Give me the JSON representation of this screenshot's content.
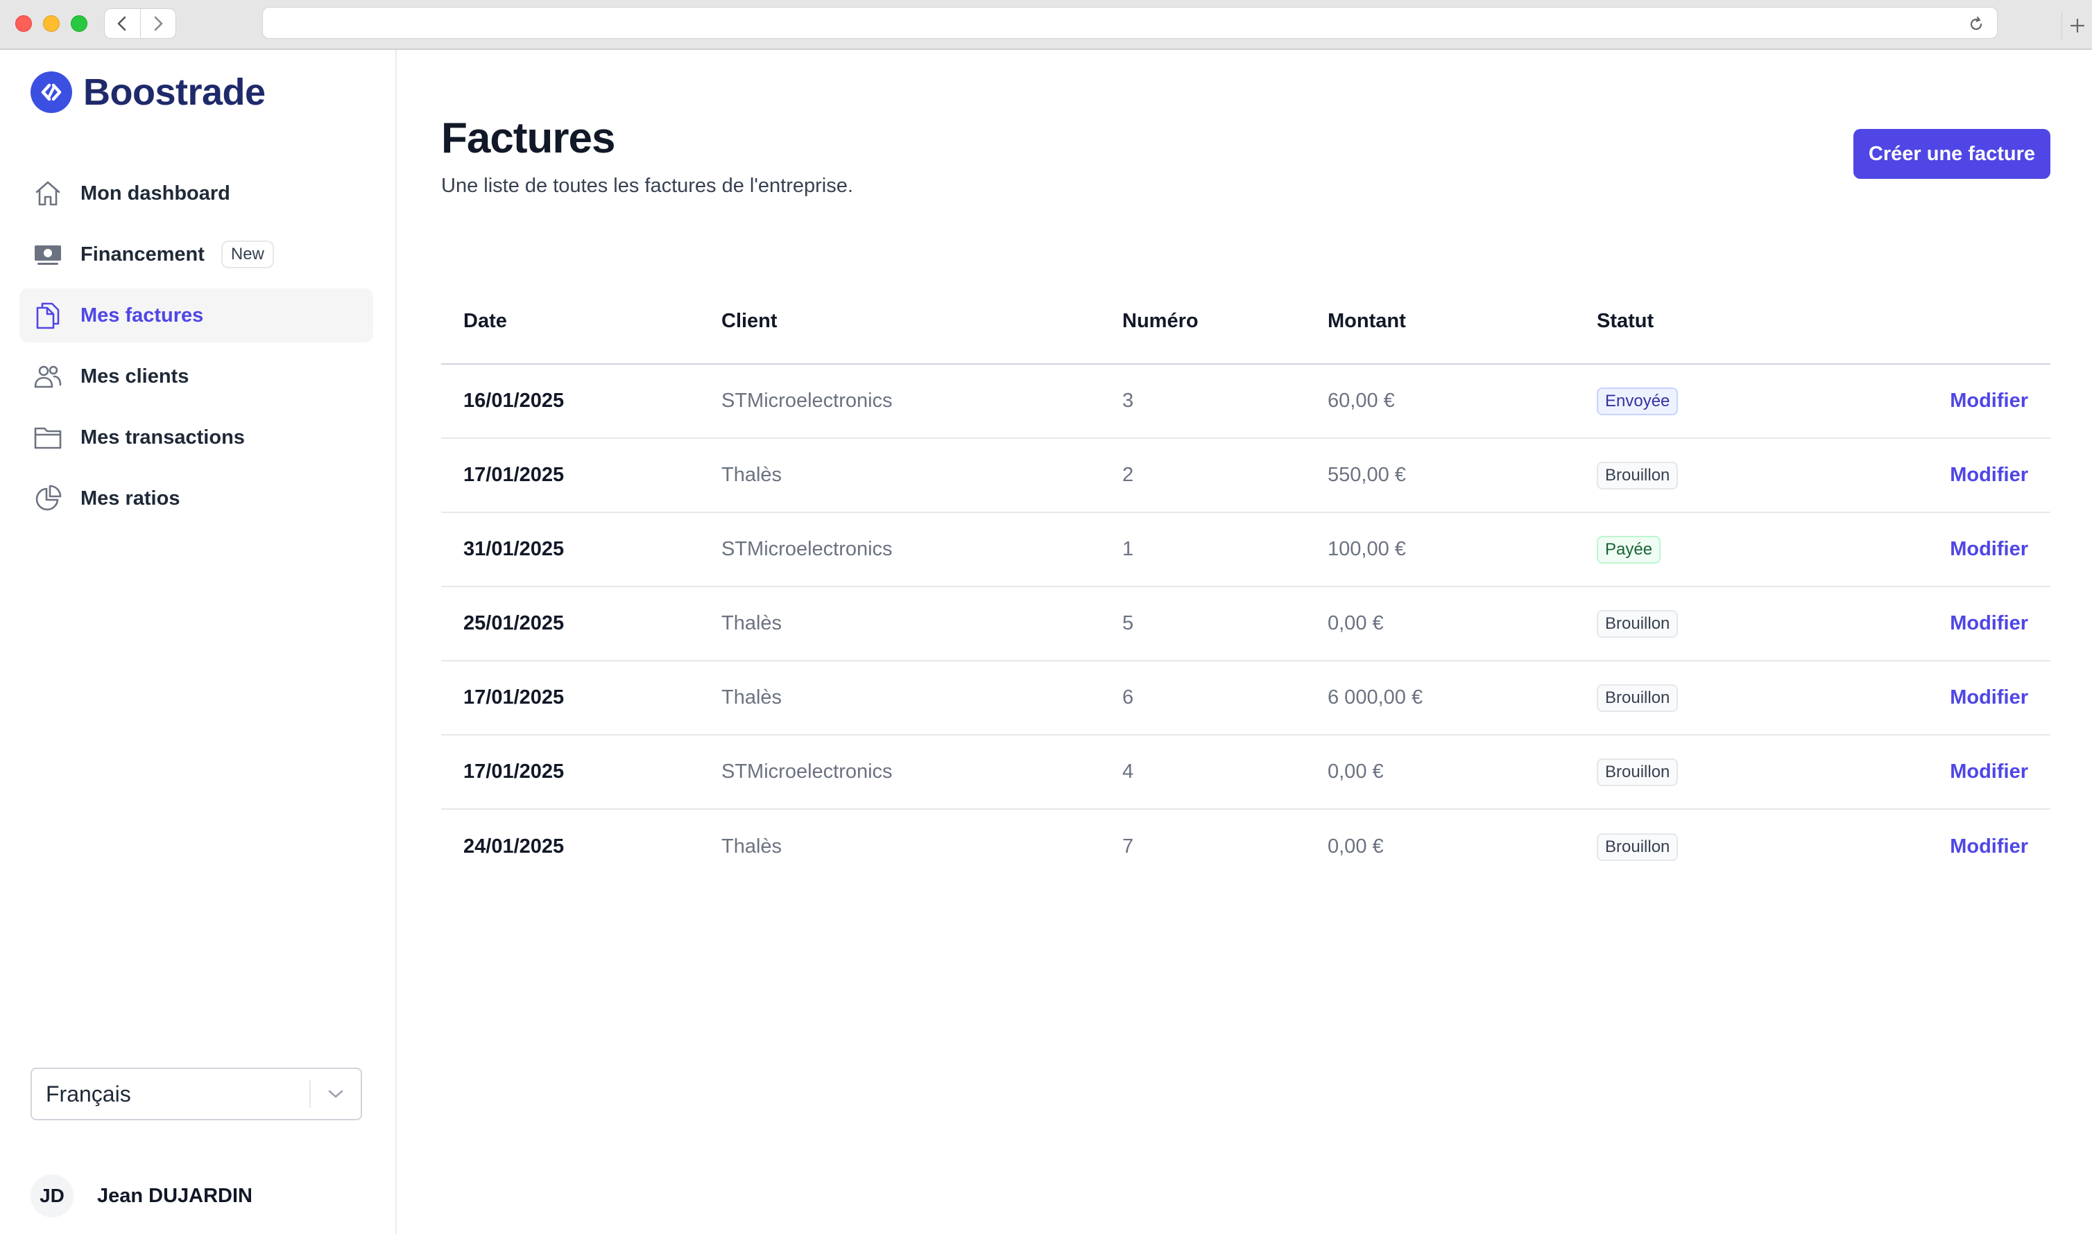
{
  "browser": {
    "url": "",
    "back_icon": "chevron-left-icon",
    "forward_icon": "chevron-right-icon",
    "reload_icon": "reload-icon",
    "new_tab_icon": "plus-icon"
  },
  "brand": {
    "name": "Boostrade",
    "color": "#3b50e0"
  },
  "sidebar": {
    "items": [
      {
        "label": "Mon dashboard",
        "icon": "home-icon",
        "active": false
      },
      {
        "label": "Financement",
        "icon": "banknotes-icon",
        "badge": "New",
        "active": false
      },
      {
        "label": "Mes factures",
        "icon": "documents-icon",
        "active": true
      },
      {
        "label": "Mes clients",
        "icon": "users-icon",
        "active": false
      },
      {
        "label": "Mes transactions",
        "icon": "folder-icon",
        "active": false
      },
      {
        "label": "Mes ratios",
        "icon": "pie-chart-icon",
        "active": false
      }
    ],
    "language": {
      "selected": "Français"
    },
    "user": {
      "initials": "JD",
      "name": "Jean DUJARDIN"
    }
  },
  "main": {
    "title": "Factures",
    "subtitle": "Une liste de toutes les factures de l'entreprise.",
    "create_button": "Créer une facture",
    "accent_color": "#4f46e5",
    "table": {
      "headers": {
        "date": "Date",
        "client": "Client",
        "number": "Numéro",
        "amount": "Montant",
        "status": "Statut"
      },
      "action_label": "Modifier",
      "rows": [
        {
          "date": "16/01/2025",
          "client": "STMicroelectronics",
          "number": "3",
          "amount": "60,00 €",
          "status": "Envoyée"
        },
        {
          "date": "17/01/2025",
          "client": "Thalès",
          "number": "2",
          "amount": "550,00 €",
          "status": "Brouillon"
        },
        {
          "date": "31/01/2025",
          "client": "STMicroelectronics",
          "number": "1",
          "amount": "100,00 €",
          "status": "Payée"
        },
        {
          "date": "25/01/2025",
          "client": "Thalès",
          "number": "5",
          "amount": "0,00 €",
          "status": "Brouillon"
        },
        {
          "date": "17/01/2025",
          "client": "Thalès",
          "number": "6",
          "amount": "6 000,00 €",
          "status": "Brouillon"
        },
        {
          "date": "17/01/2025",
          "client": "STMicroelectronics",
          "number": "4",
          "amount": "0,00 €",
          "status": "Brouillon"
        },
        {
          "date": "24/01/2025",
          "client": "Thalès",
          "number": "7",
          "amount": "0,00 €",
          "status": "Brouillon"
        }
      ]
    }
  }
}
